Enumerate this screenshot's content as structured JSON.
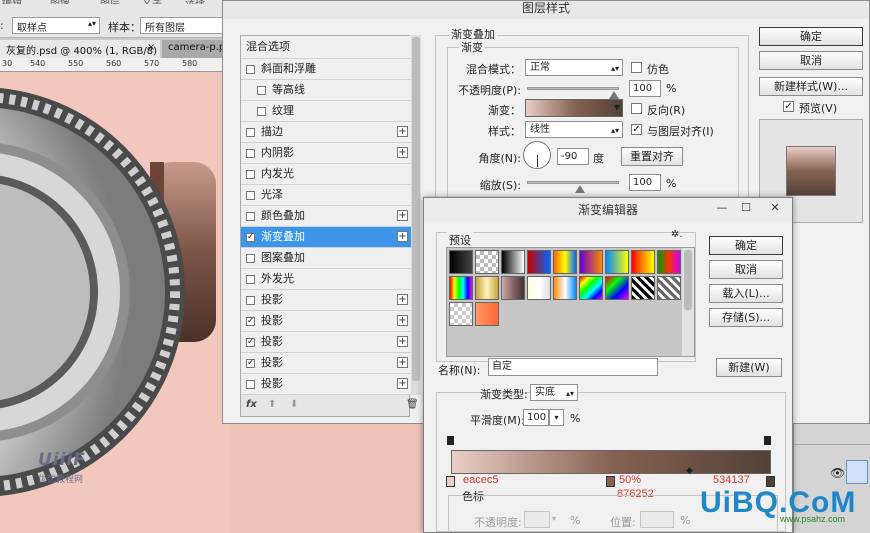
{
  "photoshop": {
    "menu_labels": [
      "编辑",
      "图像",
      "图层",
      "文字",
      "选择"
    ],
    "options_bar": {
      "sample_size": "取样点",
      "sample_label": "样本：",
      "sample_value": "所有图层"
    },
    "doc_tabs": [
      "灰复的.psd @ 400% (1, RGB/8) *",
      "camera-p.psd"
    ],
    "ruler_ticks": [
      "30",
      "540",
      "550",
      "560",
      "570",
      "580"
    ],
    "watermark_cn": "优优教程网",
    "site_watermark": "UiBQ.CoM",
    "site_watermark_sub": "www.psahz.com"
  },
  "layer_style": {
    "title": "图层样式",
    "blend_options": "混合选项",
    "items": [
      {
        "label": "斜面和浮雕",
        "checked": false,
        "indent": false,
        "plus": false
      },
      {
        "label": "等高线",
        "checked": false,
        "indent": true,
        "plus": false
      },
      {
        "label": "纹理",
        "checked": false,
        "indent": true,
        "plus": false
      },
      {
        "label": "描边",
        "checked": false,
        "indent": false,
        "plus": true
      },
      {
        "label": "内阴影",
        "checked": false,
        "indent": false,
        "plus": true
      },
      {
        "label": "内发光",
        "checked": false,
        "indent": false,
        "plus": false
      },
      {
        "label": "光泽",
        "checked": false,
        "indent": false,
        "plus": false
      },
      {
        "label": "颜色叠加",
        "checked": false,
        "indent": false,
        "plus": true
      },
      {
        "label": "渐变叠加",
        "checked": true,
        "indent": false,
        "plus": true,
        "selected": true
      },
      {
        "label": "图案叠加",
        "checked": false,
        "indent": false,
        "plus": false
      },
      {
        "label": "外发光",
        "checked": false,
        "indent": false,
        "plus": false
      },
      {
        "label": "投影",
        "checked": false,
        "indent": false,
        "plus": true
      },
      {
        "label": "投影",
        "checked": true,
        "indent": false,
        "plus": true
      },
      {
        "label": "投影",
        "checked": true,
        "indent": false,
        "plus": true
      },
      {
        "label": "投影",
        "checked": true,
        "indent": false,
        "plus": true
      },
      {
        "label": "投影",
        "checked": false,
        "indent": false,
        "plus": true
      }
    ],
    "footer_fx": "fx",
    "section_title": "渐变叠加",
    "group_title": "渐变",
    "blend_mode_label": "混合模式：",
    "blend_mode_value": "正常",
    "dither_label": "仿色",
    "opacity_label": "不透明度(P):",
    "opacity_value": "100",
    "percent": "%",
    "gradient_label": "渐变：",
    "reverse_label": "反向(R)",
    "style_label": "样式：",
    "style_value": "线性",
    "align_label": "与图层对齐(I)",
    "angle_label": "角度(N):",
    "angle_value": "-90",
    "degree": "度",
    "reset_align": "重置对齐",
    "scale_label": "缩放(S):",
    "scale_value": "100",
    "buttons": {
      "ok": "确定",
      "cancel": "取消",
      "new_style": "新建样式(W)...",
      "preview": "预览(V)"
    }
  },
  "gradient_editor": {
    "title": "渐变编辑器",
    "presets_label": "预设",
    "gear": "✲.",
    "buttons": {
      "ok": "确定",
      "cancel": "取消",
      "load": "载入(L)...",
      "save": "存储(S)...",
      "new": "新建(W)"
    },
    "name_label": "名称(N):",
    "name_value": "自定",
    "type_label": "渐变类型:",
    "type_value": "实底",
    "smooth_label": "平滑度(M):",
    "smooth_value": "100",
    "percent": "%",
    "stops_group": "色标",
    "stop_opacity_label": "不透明度:",
    "stop_position_label": "位置:",
    "stops": [
      {
        "color": "#eacec5",
        "label": "eacec5",
        "location": 0
      },
      {
        "color": "#876252",
        "label": "876252",
        "location": 50
      },
      {
        "color": "#534137",
        "label": "534137",
        "location": 100
      }
    ],
    "midpoint_label": "50%"
  },
  "colors": {
    "accent_selected": "#3b95e8",
    "annotation_red": "#d03a2e",
    "canvas_pink": "#f2c8be"
  }
}
